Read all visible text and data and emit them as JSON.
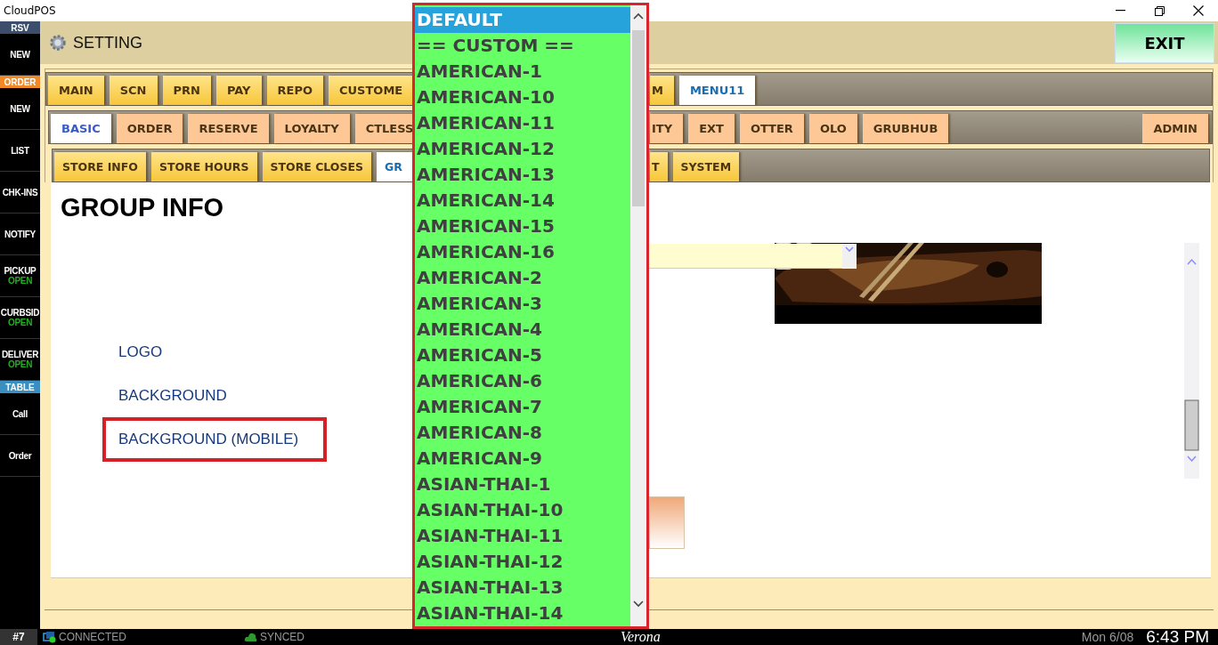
{
  "window": {
    "title": "CloudPOS"
  },
  "sidebar": {
    "items": [
      {
        "kind": "header",
        "label": "RSV",
        "color": "#3d4e6c"
      },
      {
        "kind": "button",
        "label": "NEW"
      },
      {
        "kind": "header",
        "label": "ORDER",
        "color": "#f08a28"
      },
      {
        "kind": "button",
        "label": "NEW"
      },
      {
        "kind": "button",
        "label": "LIST"
      },
      {
        "kind": "button",
        "label": "CHK-INS"
      },
      {
        "kind": "button",
        "label": "NOTIFY"
      },
      {
        "kind": "button",
        "label": "PICKUP",
        "status": "OPEN"
      },
      {
        "kind": "button",
        "label": "CURBSID",
        "status": "OPEN"
      },
      {
        "kind": "button",
        "label": "DELIVER",
        "status": "OPEN"
      },
      {
        "kind": "header",
        "label": "TABLE",
        "color": "#3b8fc0"
      },
      {
        "kind": "button",
        "label": "Call"
      },
      {
        "kind": "button",
        "label": "Order"
      }
    ]
  },
  "header": {
    "title": "SETTING",
    "exit_button": "EXIT"
  },
  "tab_rows": [
    {
      "left": [
        {
          "label": "MAIN",
          "selected": false
        },
        {
          "label": "SCN",
          "selected": false
        },
        {
          "label": "PRN",
          "selected": false
        },
        {
          "label": "PAY",
          "selected": false
        },
        {
          "label": "REPO",
          "selected": false
        },
        {
          "label": "CUSTOME",
          "selected": false
        }
      ],
      "right": [
        {
          "label": "M",
          "selected": false
        },
        {
          "label": "MENU11",
          "selected": true
        }
      ],
      "end": []
    },
    {
      "left": [
        {
          "label": "BASIC",
          "selected": true
        },
        {
          "label": "ORDER",
          "selected": false
        },
        {
          "label": "RESERVE",
          "selected": false
        },
        {
          "label": "LOYALTY",
          "selected": false
        },
        {
          "label": "CTLESS",
          "selected": false
        }
      ],
      "right": [
        {
          "label": "ITY",
          "selected": false
        },
        {
          "label": "EXT",
          "selected": false
        },
        {
          "label": "OTTER",
          "selected": false
        },
        {
          "label": "OLO",
          "selected": false
        },
        {
          "label": "GRUBHUB",
          "selected": false
        }
      ],
      "end": [
        {
          "label": "ADMIN",
          "selected": false
        }
      ]
    },
    {
      "left": [
        {
          "label": "STORE INFO",
          "selected": false
        },
        {
          "label": "STORE HOURS",
          "selected": false
        },
        {
          "label": "STORE CLOSES",
          "selected": false
        },
        {
          "label": "GR",
          "selected": true
        }
      ],
      "right": [
        {
          "label": "T",
          "selected": false
        },
        {
          "label": "SYSTEM",
          "selected": false
        }
      ],
      "end": []
    }
  ],
  "content": {
    "heading": "GROUP INFO",
    "labels": [
      {
        "text": "LOGO",
        "highlighted": false
      },
      {
        "text": "BACKGROUND",
        "highlighted": false
      },
      {
        "text": "BACKGROUND (MOBILE)",
        "highlighted": true
      }
    ],
    "theme_select": {
      "open": true,
      "options": [
        {
          "label": "DEFAULT",
          "selected": true
        },
        {
          "label": "== CUSTOM ==",
          "selected": false
        },
        {
          "label": "AMERICAN-1",
          "selected": false
        },
        {
          "label": "AMERICAN-10",
          "selected": false
        },
        {
          "label": "AMERICAN-11",
          "selected": false
        },
        {
          "label": "AMERICAN-12",
          "selected": false
        },
        {
          "label": "AMERICAN-13",
          "selected": false
        },
        {
          "label": "AMERICAN-14",
          "selected": false
        },
        {
          "label": "AMERICAN-15",
          "selected": false
        },
        {
          "label": "AMERICAN-16",
          "selected": false
        },
        {
          "label": "AMERICAN-2",
          "selected": false
        },
        {
          "label": "AMERICAN-3",
          "selected": false
        },
        {
          "label": "AMERICAN-4",
          "selected": false
        },
        {
          "label": "AMERICAN-5",
          "selected": false
        },
        {
          "label": "AMERICAN-6",
          "selected": false
        },
        {
          "label": "AMERICAN-7",
          "selected": false
        },
        {
          "label": "AMERICAN-8",
          "selected": false
        },
        {
          "label": "AMERICAN-9",
          "selected": false
        },
        {
          "label": "ASIAN-THAI-1",
          "selected": false
        },
        {
          "label": "ASIAN-THAI-10",
          "selected": false
        },
        {
          "label": "ASIAN-THAI-11",
          "selected": false
        },
        {
          "label": "ASIAN-THAI-12",
          "selected": false
        },
        {
          "label": "ASIAN-THAI-13",
          "selected": false
        },
        {
          "label": "ASIAN-THAI-14",
          "selected": false
        }
      ]
    }
  },
  "status_bar": {
    "terminal": "#7",
    "connection": "CONNECTED",
    "sync": "SYNCED",
    "store": "Verona",
    "date": "Mon 6/08",
    "time": "6:43 PM"
  }
}
